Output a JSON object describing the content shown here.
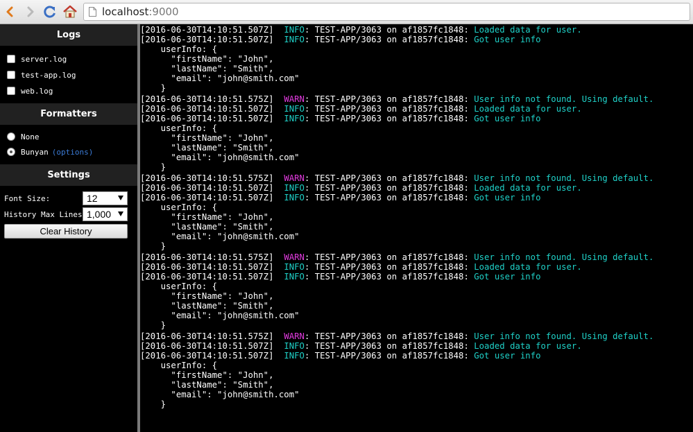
{
  "browser": {
    "url_host": "localhost",
    "url_port": ":9000"
  },
  "sidebar": {
    "logs_title": "Logs",
    "logs": [
      "server.log",
      "test-app.log",
      "web.log"
    ],
    "formatters_title": "Formatters",
    "formatter_none": "None",
    "formatter_bunyan": "Bunyan",
    "formatter_options": "(options)",
    "settings_title": "Settings",
    "font_size_label": "Font Size:",
    "font_size_value": "12",
    "history_label": "History Max Lines:",
    "history_value": "1,000",
    "clear_button": "Clear History"
  },
  "colors": {
    "info": "#1fd1c8",
    "warn": "#e33be0"
  },
  "log": {
    "lines": [
      {
        "ts": "[2016-06-30T14:10:51.507Z]",
        "level": "INFO",
        "src": ": TEST-APP/3063 on af1857fc1848: ",
        "msg": "Loaded data for user."
      },
      {
        "ts": "[2016-06-30T14:10:51.507Z]",
        "level": "INFO",
        "src": ": TEST-APP/3063 on af1857fc1848: ",
        "msg": "Got user info"
      },
      {
        "text": "    userInfo: {"
      },
      {
        "text": "      \"firstName\": \"John\","
      },
      {
        "text": "      \"lastName\": \"Smith\","
      },
      {
        "text": "      \"email\": \"john@smith.com\""
      },
      {
        "text": "    }"
      },
      {
        "ts": "[2016-06-30T14:10:51.575Z]",
        "level": "WARN",
        "src": ": TEST-APP/3063 on af1857fc1848: ",
        "msg": "User info not found. Using default."
      },
      {
        "ts": "[2016-06-30T14:10:51.507Z]",
        "level": "INFO",
        "src": ": TEST-APP/3063 on af1857fc1848: ",
        "msg": "Loaded data for user."
      },
      {
        "ts": "[2016-06-30T14:10:51.507Z]",
        "level": "INFO",
        "src": ": TEST-APP/3063 on af1857fc1848: ",
        "msg": "Got user info"
      },
      {
        "text": "    userInfo: {"
      },
      {
        "text": "      \"firstName\": \"John\","
      },
      {
        "text": "      \"lastName\": \"Smith\","
      },
      {
        "text": "      \"email\": \"john@smith.com\""
      },
      {
        "text": "    }"
      },
      {
        "ts": "[2016-06-30T14:10:51.575Z]",
        "level": "WARN",
        "src": ": TEST-APP/3063 on af1857fc1848: ",
        "msg": "User info not found. Using default."
      },
      {
        "ts": "[2016-06-30T14:10:51.507Z]",
        "level": "INFO",
        "src": ": TEST-APP/3063 on af1857fc1848: ",
        "msg": "Loaded data for user."
      },
      {
        "ts": "[2016-06-30T14:10:51.507Z]",
        "level": "INFO",
        "src": ": TEST-APP/3063 on af1857fc1848: ",
        "msg": "Got user info"
      },
      {
        "text": "    userInfo: {"
      },
      {
        "text": "      \"firstName\": \"John\","
      },
      {
        "text": "      \"lastName\": \"Smith\","
      },
      {
        "text": "      \"email\": \"john@smith.com\""
      },
      {
        "text": "    }"
      },
      {
        "ts": "[2016-06-30T14:10:51.575Z]",
        "level": "WARN",
        "src": ": TEST-APP/3063 on af1857fc1848: ",
        "msg": "User info not found. Using default."
      },
      {
        "ts": "[2016-06-30T14:10:51.507Z]",
        "level": "INFO",
        "src": ": TEST-APP/3063 on af1857fc1848: ",
        "msg": "Loaded data for user."
      },
      {
        "ts": "[2016-06-30T14:10:51.507Z]",
        "level": "INFO",
        "src": ": TEST-APP/3063 on af1857fc1848: ",
        "msg": "Got user info"
      },
      {
        "text": "    userInfo: {"
      },
      {
        "text": "      \"firstName\": \"John\","
      },
      {
        "text": "      \"lastName\": \"Smith\","
      },
      {
        "text": "      \"email\": \"john@smith.com\""
      },
      {
        "text": "    }"
      },
      {
        "ts": "[2016-06-30T14:10:51.575Z]",
        "level": "WARN",
        "src": ": TEST-APP/3063 on af1857fc1848: ",
        "msg": "User info not found. Using default."
      },
      {
        "ts": "[2016-06-30T14:10:51.507Z]",
        "level": "INFO",
        "src": ": TEST-APP/3063 on af1857fc1848: ",
        "msg": "Loaded data for user."
      },
      {
        "ts": "[2016-06-30T14:10:51.507Z]",
        "level": "INFO",
        "src": ": TEST-APP/3063 on af1857fc1848: ",
        "msg": "Got user info"
      },
      {
        "text": "    userInfo: {"
      },
      {
        "text": "      \"firstName\": \"John\","
      },
      {
        "text": "      \"lastName\": \"Smith\","
      },
      {
        "text": "      \"email\": \"john@smith.com\""
      },
      {
        "text": "    }"
      }
    ]
  }
}
